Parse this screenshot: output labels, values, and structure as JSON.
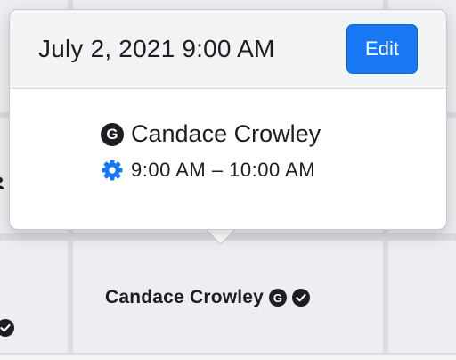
{
  "popover": {
    "title": "July 2, 2021 9:00 AM",
    "edit_label": "Edit",
    "attendee_badge": "G",
    "attendee_name": "Candace Crowley",
    "time_range": "9:00 AM – 10:00 AM"
  },
  "calendar": {
    "event_label": "Candace Crowley",
    "event_badge": "G"
  },
  "colors": {
    "accent": "#1877f2",
    "text": "#1c1e21",
    "header_bg": "#f2f3f5",
    "cell_bg": "#eceef1"
  },
  "icons": [
    "google-badge-icon",
    "gear-icon",
    "checkmark-circle-icon",
    "user-icon"
  ]
}
